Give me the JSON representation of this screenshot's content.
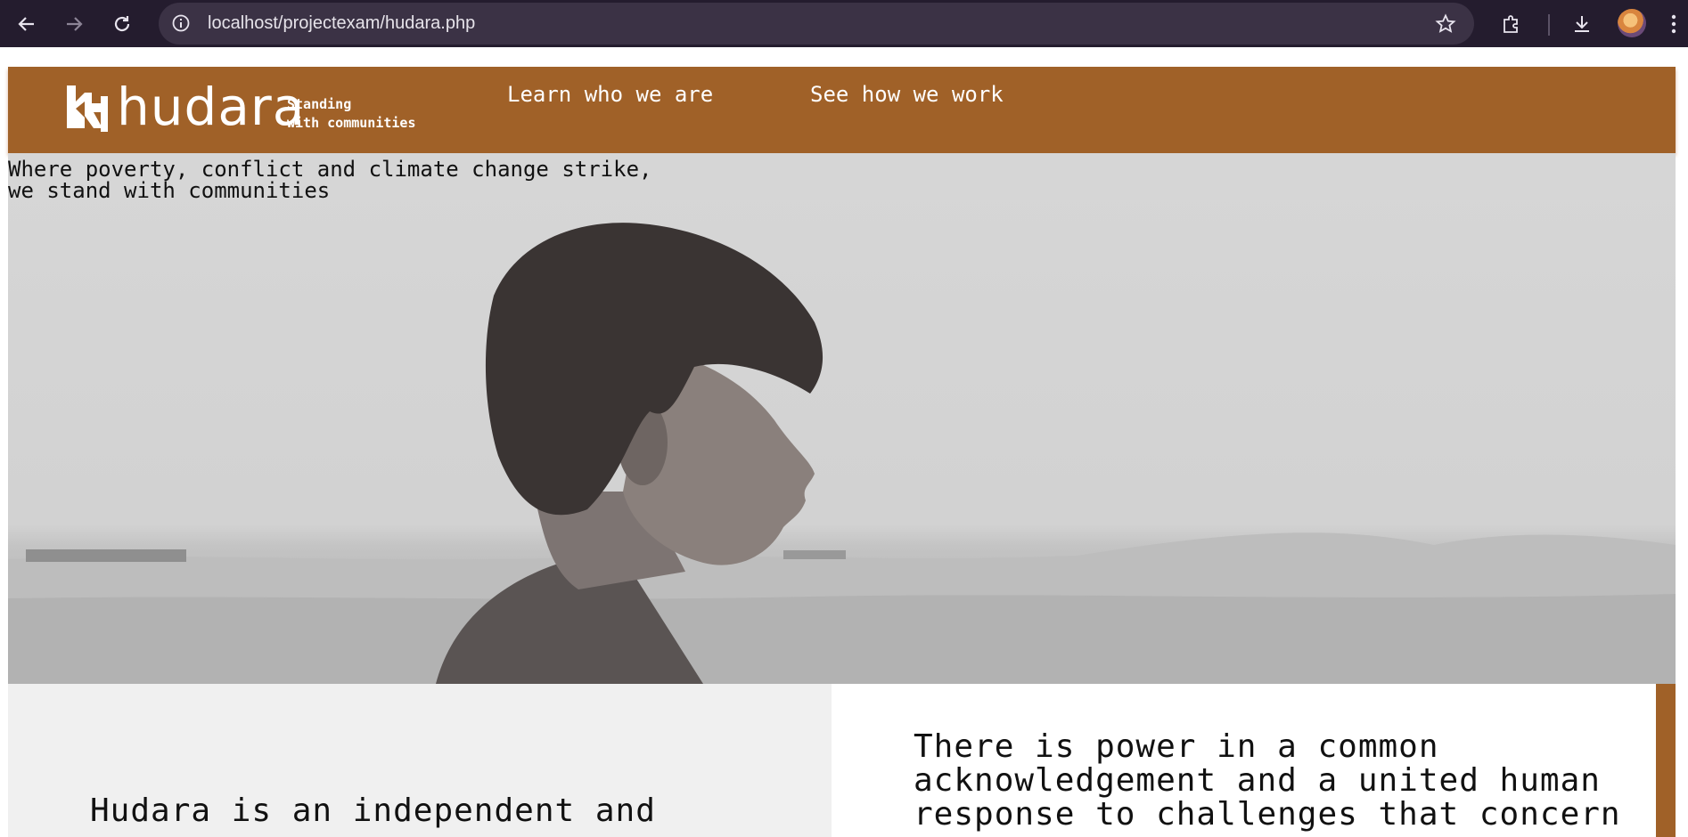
{
  "browser": {
    "url": "localhost/projectexam/hudara.php",
    "icons": {
      "back": "arrow-left-icon",
      "forward": "arrow-right-icon",
      "reload": "reload-icon",
      "site_info": "info-icon",
      "bookmark": "star-icon",
      "extensions": "puzzle-icon",
      "downloads": "download-icon",
      "menu": "kebab-menu-icon"
    }
  },
  "header": {
    "logo_text": "hudara",
    "tagline_line1": "Standing",
    "tagline_line2": "with communities",
    "nav": [
      {
        "label": "Learn who we are"
      },
      {
        "label": "See how we work"
      }
    ],
    "color": "#a06128"
  },
  "hero": {
    "line1": "Where poverty, conflict and climate change strike,",
    "line2": "we stand with communities"
  },
  "intro": {
    "left_text": "Hudara is an independent and",
    "right_line1": "There is power in a common",
    "right_line2": "acknowledgement and a united human",
    "right_line3": "response to challenges that concern"
  }
}
